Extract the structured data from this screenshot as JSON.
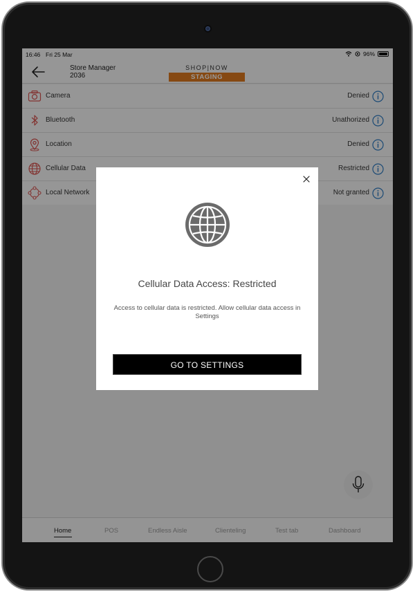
{
  "status_bar": {
    "time": "16:46",
    "date": "Fri 25 Mar",
    "battery": "96%"
  },
  "header": {
    "store_line1": "Store Manager",
    "store_line2": "2036",
    "brand": "SHOP|NOW",
    "environment": "STAGING"
  },
  "permissions": [
    {
      "label": "Camera",
      "status": "Denied",
      "icon": "camera-icon"
    },
    {
      "label": "Bluetooth",
      "status": "Unathorized",
      "icon": "bluetooth-icon"
    },
    {
      "label": "Location",
      "status": "Denied",
      "icon": "location-pin-icon"
    },
    {
      "label": "Cellular Data",
      "status": "Restricted",
      "icon": "globe-icon"
    },
    {
      "label": "Local Network",
      "status": "Not granted",
      "icon": "network-icon"
    }
  ],
  "modal": {
    "title": "Cellular Data Access: Restricted",
    "message": "Access to cellular data is restricted. Allow cellular data access in Settings",
    "button": "GO TO SETTINGS"
  },
  "tabs": [
    {
      "label": "Home",
      "active": true
    },
    {
      "label": "POS",
      "active": false
    },
    {
      "label": "Endless Aisle",
      "active": false
    },
    {
      "label": "Clienteling",
      "active": false
    },
    {
      "label": "Test tab",
      "active": false
    },
    {
      "label": "Dashboard",
      "active": false
    }
  ],
  "colors": {
    "accent_icon": "#d9534f",
    "info_icon": "#2e7cc4",
    "env_badge": "#e07b1f"
  }
}
